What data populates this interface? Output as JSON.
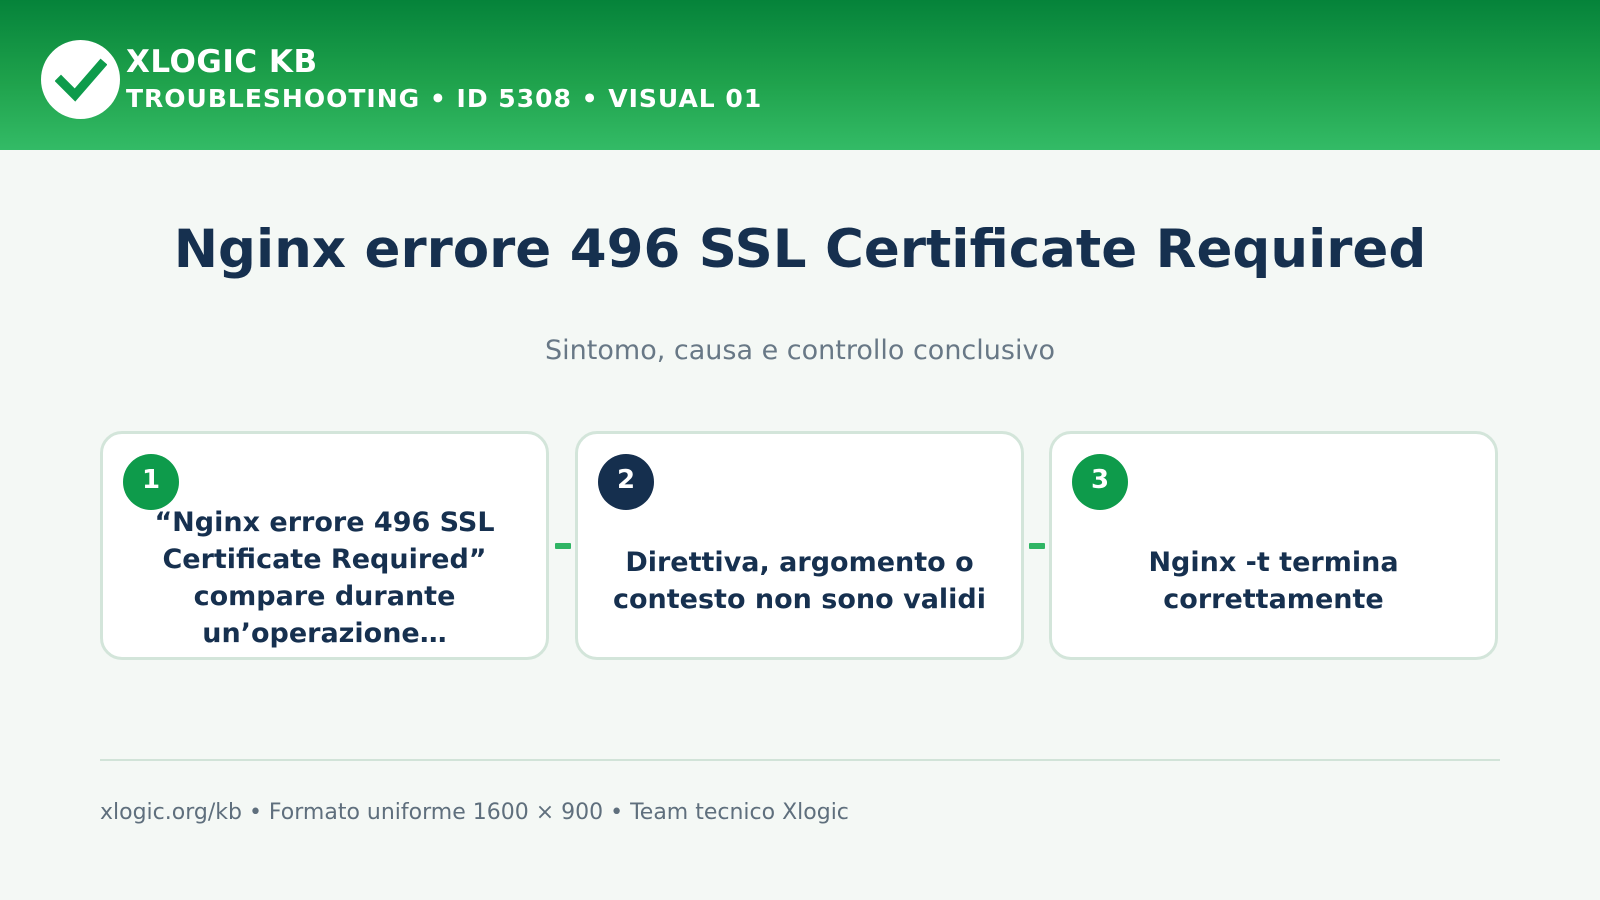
{
  "header": {
    "brand": "XLOGIC KB",
    "subtitle": "TROUBLESHOOTING • ID 5308 • VISUAL 01",
    "logo_icon": "checkmark-icon"
  },
  "title": "Nginx errore 496 SSL Certificate Required",
  "subtitle": "Sintomo, causa e controllo conclusivo",
  "steps": [
    {
      "number": "1",
      "text": "“Nginx errore 496 SSL Certificate Required” compare durante un’operazione…",
      "badge_color": "#0e9b4b"
    },
    {
      "number": "2",
      "text": "Direttiva, argomento o contesto non sono validi",
      "badge_color": "#152f4e"
    },
    {
      "number": "3",
      "text": "Nginx -t termina correttamente",
      "badge_color": "#0e9b4b"
    }
  ],
  "footer": "xlogic.org/kb • Formato uniforme 1600 × 900 • Team tecnico Xlogic",
  "colors": {
    "header_green": "#1fa24c",
    "navy": "#16304f",
    "accent_green": "#2fb564",
    "background": "#f4f8f5"
  }
}
